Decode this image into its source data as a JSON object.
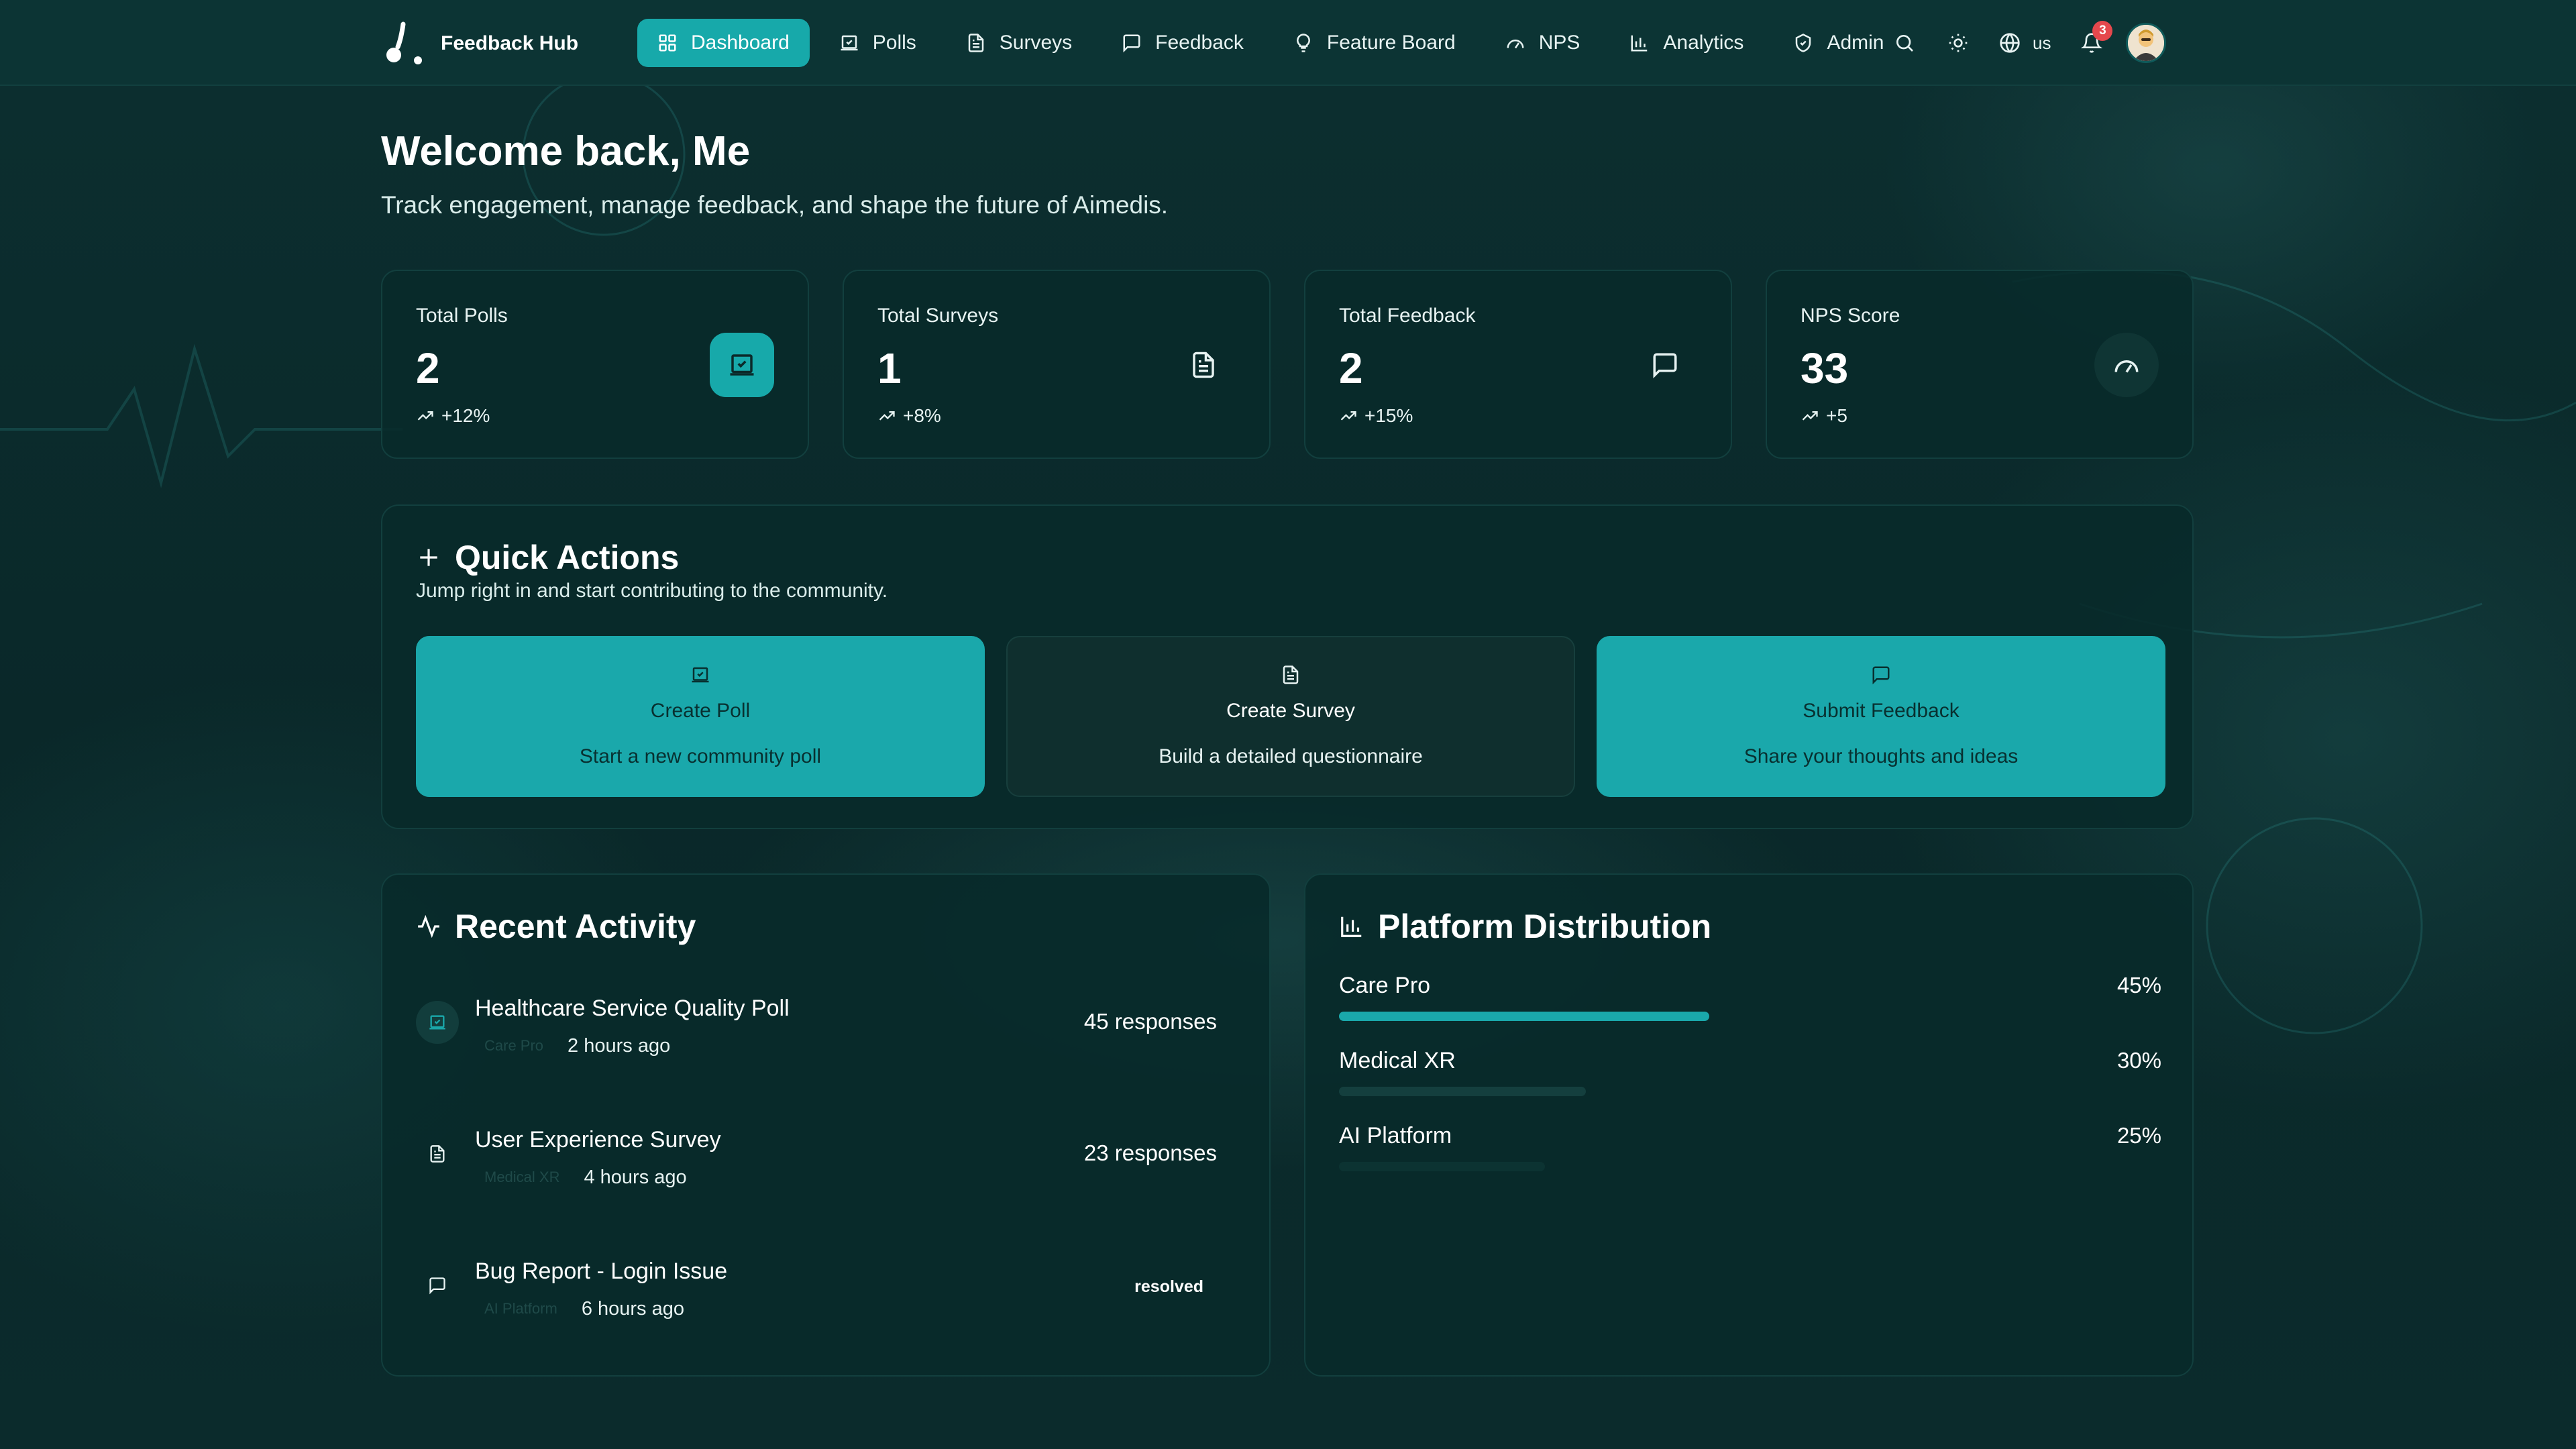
{
  "app": {
    "name": "Feedback Hub"
  },
  "nav": {
    "items": [
      {
        "label": "Dashboard",
        "icon": "dashboard-icon",
        "active": true
      },
      {
        "label": "Polls",
        "icon": "poll-icon"
      },
      {
        "label": "Surveys",
        "icon": "document-icon"
      },
      {
        "label": "Feedback",
        "icon": "message-icon"
      },
      {
        "label": "Feature Board",
        "icon": "lightbulb-icon"
      },
      {
        "label": "NPS",
        "icon": "gauge-icon"
      },
      {
        "label": "Analytics",
        "icon": "bar-chart-icon"
      },
      {
        "label": "Admin",
        "icon": "shield-icon"
      }
    ],
    "language": "us",
    "notification_count": "3"
  },
  "header": {
    "welcome": "Welcome back, Me",
    "subtitle": "Track engagement, manage feedback, and shape the future of Aimedis."
  },
  "stats": [
    {
      "label": "Total Polls",
      "value": "2",
      "delta": "+12%",
      "icon": "poll-icon"
    },
    {
      "label": "Total Surveys",
      "value": "1",
      "delta": "+8%",
      "icon": "document-icon"
    },
    {
      "label": "Total Feedback",
      "value": "2",
      "delta": "+15%",
      "icon": "message-icon"
    },
    {
      "label": "NPS Score",
      "value": "33",
      "delta": "+5",
      "icon": "gauge-icon"
    }
  ],
  "quick_actions": {
    "title": "Quick Actions",
    "subtitle": "Jump right in and start contributing to the community.",
    "buttons": [
      {
        "title": "Create Poll",
        "description": "Start a new community poll",
        "icon": "poll-icon"
      },
      {
        "title": "Create Survey",
        "description": "Build a detailed questionnaire",
        "icon": "document-icon"
      },
      {
        "title": "Submit Feedback",
        "description": "Share your thoughts and ideas",
        "icon": "message-icon"
      }
    ]
  },
  "recent_activity": {
    "title": "Recent Activity",
    "items": [
      {
        "title": "Healthcare Service Quality Poll",
        "tag": "Care Pro",
        "time": "2 hours ago",
        "right": "45 responses",
        "icon": "poll-icon"
      },
      {
        "title": "User Experience Survey",
        "tag": "Medical XR",
        "time": "4 hours ago",
        "right": "23 responses",
        "icon": "document-icon"
      },
      {
        "title": "Bug Report - Login Issue",
        "tag": "AI Platform",
        "time": "6 hours ago",
        "right": "resolved",
        "icon": "message-icon"
      }
    ]
  },
  "platform_distribution": {
    "title": "Platform Distribution",
    "items": [
      {
        "name": "Care Pro",
        "percent_label": "45%",
        "percent": 45,
        "color": "#1aa8ab"
      },
      {
        "name": "Medical XR",
        "percent_label": "30%",
        "percent": 30,
        "color": "#143f3e"
      },
      {
        "name": "AI Platform",
        "percent_label": "25%",
        "percent": 25,
        "color": "#0c3332"
      }
    ]
  },
  "colors": {
    "accent": "#17a9aa",
    "background": "#0a2a2a",
    "badge": "#e5484d"
  }
}
